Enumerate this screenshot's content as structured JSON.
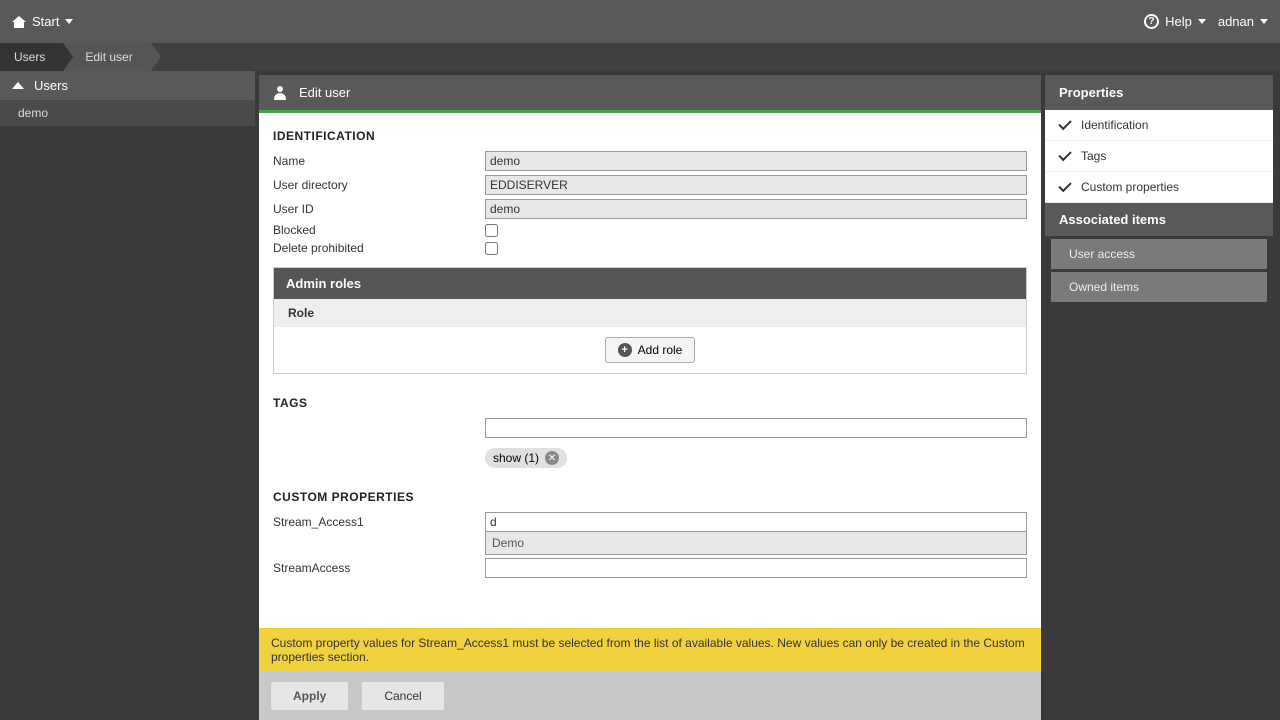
{
  "topbar": {
    "start_label": "Start",
    "help_label": "Help",
    "username": "adnan"
  },
  "breadcrumb": {
    "items": [
      "Users",
      "Edit user"
    ]
  },
  "sidebar": {
    "header": "Users",
    "items": [
      "demo"
    ]
  },
  "content": {
    "title": "Edit user",
    "identification": {
      "section_title": "IDENTIFICATION",
      "name_label": "Name",
      "name_value": "demo",
      "directory_label": "User directory",
      "directory_value": "EDDISERVER",
      "userid_label": "User ID",
      "userid_value": "demo",
      "blocked_label": "Blocked",
      "delete_prohibited_label": "Delete prohibited"
    },
    "admin_roles": {
      "title": "Admin roles",
      "role_header": "Role",
      "add_role_label": "Add role"
    },
    "tags": {
      "title": "TAGS",
      "chip_label": "show (1)"
    },
    "custom_properties": {
      "title": "CUSTOM PROPERTIES",
      "prop1_label": "Stream_Access1",
      "prop1_value": "d",
      "prop1_suggestion": "Demo",
      "prop2_label": "StreamAccess",
      "prop2_value": ""
    },
    "warning": "Custom property values for Stream_Access1 must be selected from the list of available values. New values can only be created in the Custom properties section.",
    "actions": {
      "apply": "Apply",
      "cancel": "Cancel"
    }
  },
  "rightpanel": {
    "properties_title": "Properties",
    "prop_items": [
      "Identification",
      "Tags",
      "Custom properties"
    ],
    "associated_title": "Associated items",
    "assoc_items": [
      "User access",
      "Owned items"
    ]
  }
}
